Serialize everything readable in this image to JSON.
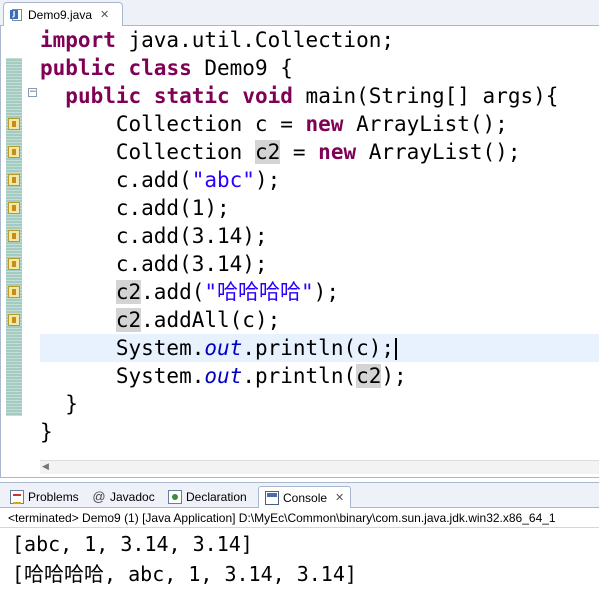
{
  "editor": {
    "tab_label": "Demo9.java",
    "close_glyph": "✕",
    "lines": {
      "l1_kw": "import",
      "l1_rest": " java.util.Collection;",
      "l2_kw1": "public",
      "l2_kw2": "class",
      "l2_rest": " Demo9 {",
      "l3_indent": "  ",
      "l3_kw1": "public",
      "l3_kw2": "static",
      "l3_kw3": "void",
      "l3_rest": " main(String[] args){",
      "l4_a": "      Collection c = ",
      "l4_kw": "new",
      "l4_b": " ArrayList();",
      "l5_a": "      Collection ",
      "l5_var": "c2",
      "l5_b": " = ",
      "l5_kw": "new",
      "l5_c": " ArrayList();",
      "l6_a": "      c.add(",
      "l6_str": "\"abc\"",
      "l6_b": ");",
      "l7": "      c.add(1);",
      "l8": "      c.add(3.14);",
      "l9": "      c.add(3.14);",
      "l10_indent": "      ",
      "l10_var": "c2",
      "l10_a": ".add(",
      "l10_str": "\"哈哈哈哈\"",
      "l10_b": ");",
      "l11_indent": "      ",
      "l11_var": "c2",
      "l11_a": ".addAll(c);",
      "l12_a": "      System.",
      "l12_fld": "out",
      "l12_b": ".println(c);",
      "l13_a": "      System.",
      "l13_fld": "out",
      "l13_b": ".println(",
      "l13_var": "c2",
      "l13_c": ");",
      "l14": "  }",
      "l15": "}"
    }
  },
  "views": {
    "tabs": {
      "problems": "Problems",
      "javadoc": "Javadoc",
      "declaration": "Declaration",
      "console": "Console"
    },
    "console_close": "✕",
    "status": "<terminated> Demo9 (1) [Java Application] D:\\MyEc\\Common\\binary\\com.sun.java.jdk.win32.x86_64_1",
    "output": [
      "[abc, 1, 3.14, 3.14]",
      "[哈哈哈哈, abc, 1, 3.14, 3.14]"
    ]
  },
  "colors": {
    "keyword": "#7f0055",
    "string": "#2a00ff",
    "static_field": "#0000c0",
    "current_line": "#e8f2fe",
    "occurrence_highlight": "#d4d4d4"
  },
  "icons": [
    "java-file-icon",
    "close-icon",
    "warning-marker-icon",
    "fold-collapse-icon",
    "problems-icon",
    "javadoc-icon",
    "declaration-icon",
    "console-icon"
  ]
}
